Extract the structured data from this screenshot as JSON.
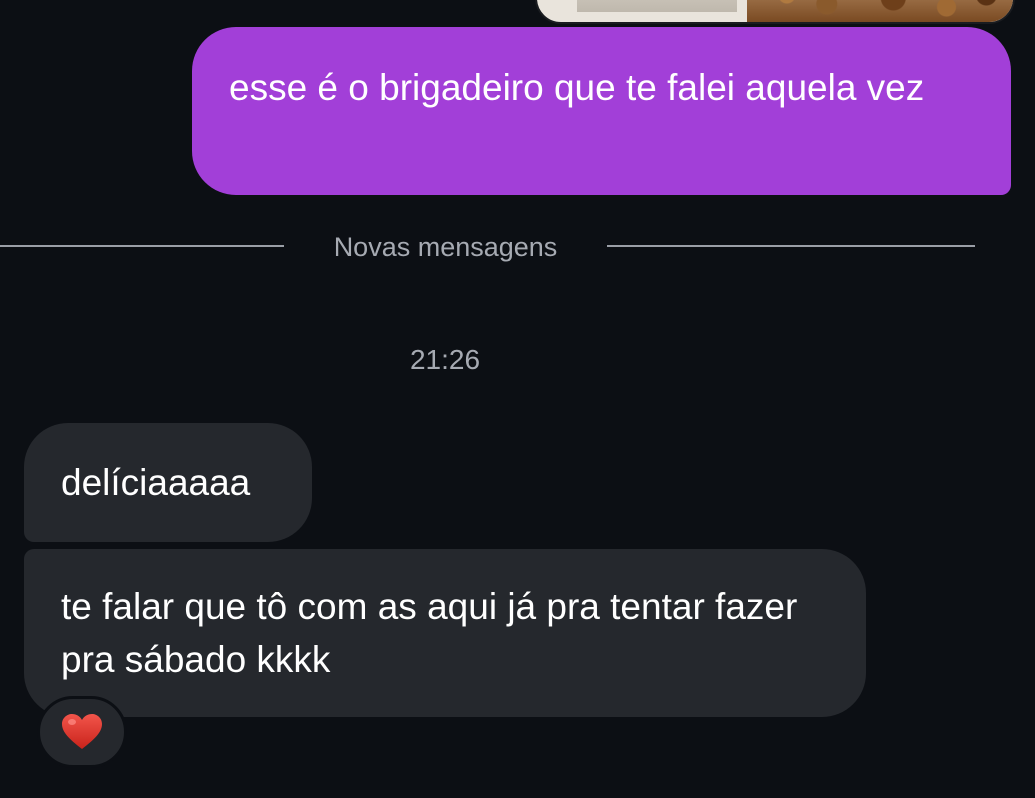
{
  "conversation": {
    "messages": [
      {
        "direction": "outgoing",
        "type": "image",
        "image_description_icon": "photo-attachment"
      },
      {
        "direction": "outgoing",
        "type": "text",
        "text": "esse é o brigadeiro que te falei aquela vez"
      },
      {
        "direction": "incoming",
        "type": "text",
        "text": "delíciaaaaa"
      },
      {
        "direction": "incoming",
        "type": "text",
        "text": "te falar que tô com as aqui já pra tentar fazer pra sábado kkkk",
        "reaction": {
          "emoji": "❤️",
          "icon": "red-heart-icon"
        }
      }
    ],
    "divider": {
      "label": "Novas mensagens"
    },
    "timestamp": "21:26"
  },
  "colors": {
    "background": "#0c0f14",
    "outgoing_bubble": "#a23fd8",
    "incoming_bubble": "#25282d",
    "muted_text": "#a6aab2",
    "heart": "#e0342b"
  }
}
